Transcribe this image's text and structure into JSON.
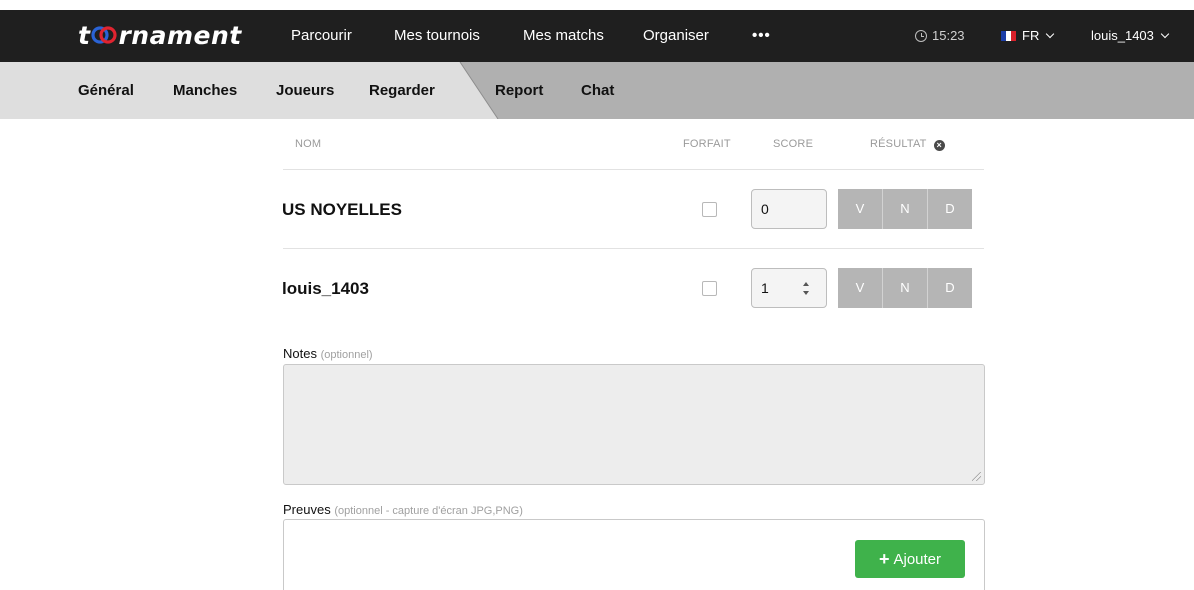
{
  "app": {
    "logo_prefix": "t",
    "logo_suffix": "rnament",
    "brand_colors": {
      "ring_blue": "#2a63d6",
      "ring_red": "#e02430"
    }
  },
  "topnav": {
    "items": [
      "Parcourir",
      "Mes tournois",
      "Mes matchs",
      "Organiser"
    ],
    "more": "•••",
    "time": "15:23",
    "language": "FR",
    "user": "louis_1403"
  },
  "subnav": {
    "items": [
      "Général",
      "Manches",
      "Joueurs",
      "Regarder",
      "Report",
      "Chat"
    ]
  },
  "table": {
    "headers": {
      "name": "NOM",
      "forfeit": "FORFAIT",
      "score": "SCORE",
      "result": "RÉSULTAT"
    },
    "rows": [
      {
        "team": "US NOYELLES",
        "forfeit": false,
        "score": "0",
        "results": [
          "V",
          "N",
          "D"
        ]
      },
      {
        "team": "louis_1403",
        "forfeit": false,
        "score": "1",
        "results": [
          "V",
          "N",
          "D"
        ]
      }
    ]
  },
  "notes": {
    "label": "Notes",
    "optional": "(optionnel)",
    "value": ""
  },
  "proofs": {
    "label": "Preuves",
    "optional": "(optionnel - capture d'écran JPG,PNG)",
    "add_button": "Ajouter"
  },
  "colors": {
    "topbar": "#1f1f1f",
    "subbar": "#b0b0b0",
    "subbar_light": "#dedede",
    "result_button": "#b5b5b5",
    "add_button": "#3fb24b"
  }
}
